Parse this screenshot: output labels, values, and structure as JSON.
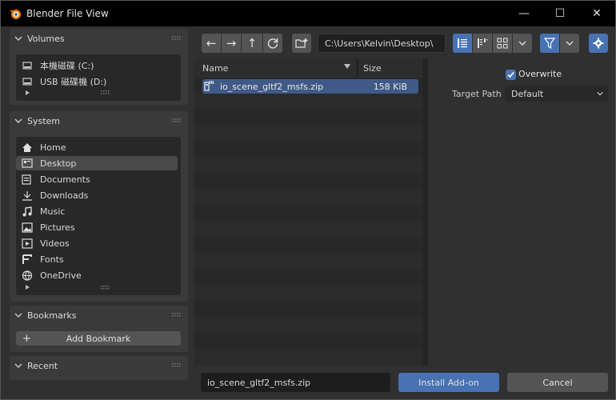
{
  "window": {
    "title": "Blender File View",
    "controls": {
      "minimize": "—",
      "maximize": "☐",
      "close": "✕"
    }
  },
  "sidebar": {
    "volumes": {
      "title": "Volumes",
      "items": [
        {
          "label": "本機磁碟 (C:)"
        },
        {
          "label": "USB 磁碟機 (D:)"
        }
      ]
    },
    "system": {
      "title": "System",
      "items": [
        {
          "label": "Home"
        },
        {
          "label": "Desktop"
        },
        {
          "label": "Documents"
        },
        {
          "label": "Downloads"
        },
        {
          "label": "Music"
        },
        {
          "label": "Pictures"
        },
        {
          "label": "Videos"
        },
        {
          "label": "Fonts"
        },
        {
          "label": "OneDrive"
        }
      ],
      "selected": "Desktop"
    },
    "bookmarks": {
      "title": "Bookmarks",
      "add_label": "Add Bookmark",
      "add_icon": "+"
    },
    "recent": {
      "title": "Recent"
    }
  },
  "toolbar": {
    "back": "←",
    "forward": "→",
    "parent": "↑",
    "path": "C:\\Users\\Kelvin\\Desktop\\"
  },
  "filelist": {
    "columns": {
      "name": "Name",
      "size": "Size"
    },
    "files": [
      {
        "name": "io_scene_gltf2_msfs.zip",
        "size": "158 KiB"
      }
    ]
  },
  "options": {
    "overwrite_label": "Overwrite",
    "overwrite_checked": true,
    "target_path_label": "Target Path",
    "target_path_value": "Default"
  },
  "bottom": {
    "filename": "io_scene_gltf2_msfs.zip",
    "install_label": "Install Add-on",
    "cancel_label": "Cancel"
  },
  "colors": {
    "accent": "#4772b3",
    "selection": "#3f5a87"
  }
}
